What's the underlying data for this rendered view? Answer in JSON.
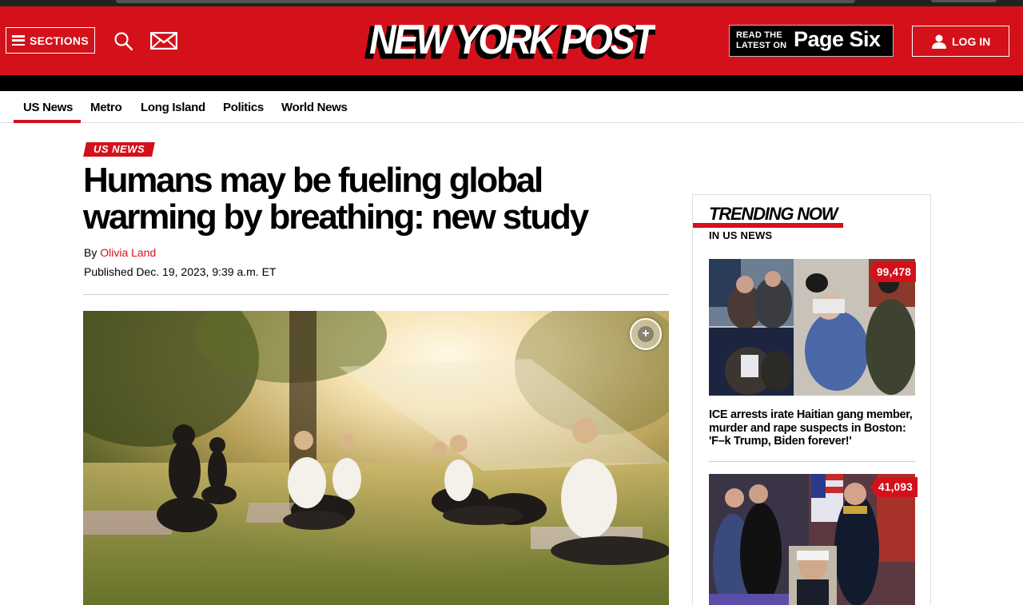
{
  "header": {
    "sections_label": "SECTIONS",
    "logo_text": "NEW YORK POST",
    "pagesix_small_line1": "READ THE",
    "pagesix_small_line2": "LATEST ON",
    "pagesix_big": "Page Six",
    "login_label": "LOG IN",
    "brand_color": "#d4111b"
  },
  "subnav": {
    "items": [
      "US News",
      "Metro",
      "Long Island",
      "Politics",
      "World News"
    ],
    "active": "US News"
  },
  "article": {
    "tag": "US NEWS",
    "headline": "Humans may be fueling global warming by breathing: new study",
    "by_prefix": "By",
    "author": "Olivia Land",
    "published": "Published Dec. 19, 2023, 9:39 a.m. ET",
    "expand_icon": "+"
  },
  "sidebar": {
    "title": "TRENDING NOW",
    "subtitle": "IN US NEWS",
    "items": [
      {
        "count": "99,478",
        "headline": "ICE arrests irate Haitian gang member, murder and rape suspects in Boston: 'F–k Trump, Biden forever!'"
      },
      {
        "count": "41,093"
      }
    ]
  }
}
